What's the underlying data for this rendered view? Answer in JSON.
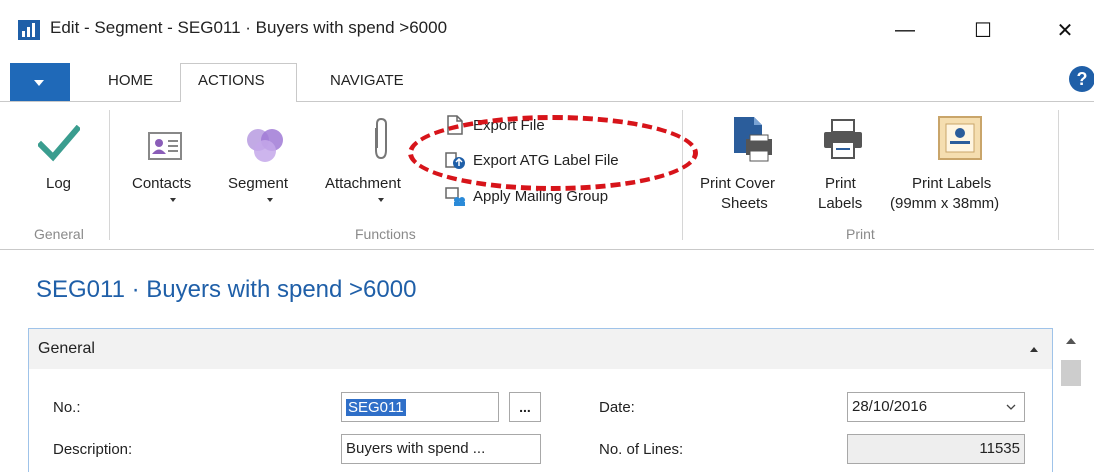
{
  "window": {
    "title": "Edit - Segment - SEG011 · Buyers with spend >6000",
    "minimize": "—",
    "maximize": "☐",
    "close": "✕"
  },
  "ribbon": {
    "tabs": [
      "HOME",
      "ACTIONS",
      "NAVIGATE"
    ],
    "active_tab": "ACTIONS",
    "help": "?",
    "groups": {
      "general": {
        "label": "General",
        "log_label": "Log"
      },
      "functions": {
        "label": "Functions",
        "contacts_label": "Contacts",
        "segment_label": "Segment",
        "attachment_label": "Attachment",
        "export_file_label": "Export File",
        "export_atg_label": "Export ATG Label File",
        "apply_mailing_group_label": "Apply Mailing Group"
      },
      "print": {
        "label": "Print",
        "print_cover_line1": "Print Cover",
        "print_cover_line2": "Sheets",
        "print_labels_line1": "Print",
        "print_labels_line2": "Labels",
        "print_labels_99_line1": "Print Labels",
        "print_labels_99_line2": "(99mm x 38mm)"
      }
    }
  },
  "page": {
    "title": "SEG011 · Buyers with spend >6000"
  },
  "general_tab": {
    "title": "General",
    "fields": {
      "no_label": "No.:",
      "no_value": "SEG011",
      "lookup": "...",
      "description_label": "Description:",
      "description_value": "Buyers with spend ...",
      "date_label": "Date:",
      "date_value": "28/10/2016",
      "no_of_lines_label": "No. of Lines:",
      "no_of_lines_value": "11535"
    }
  },
  "colors": {
    "accent": "#1f5fa8",
    "app_menu": "#1f69b8",
    "annotation": "#d7141a",
    "check": "#3a9d8f"
  }
}
